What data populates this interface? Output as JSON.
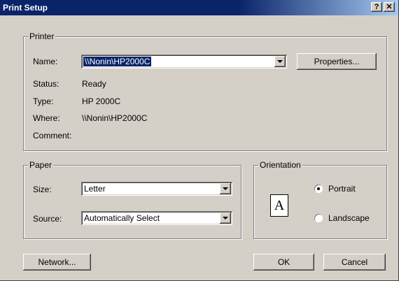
{
  "dialog": {
    "title": "Print Setup",
    "help_btn": "?",
    "close_btn": "✕"
  },
  "printer": {
    "group_label": "Printer",
    "name_label": "Name:",
    "name_value": "\\\\Nonin\\HP2000C",
    "properties_button": "Properties...",
    "status_label": "Status:",
    "status_value": "Ready",
    "type_label": "Type:",
    "type_value": "HP 2000C",
    "where_label": "Where:",
    "where_value": "\\\\Nonin\\HP2000C",
    "comment_label": "Comment:",
    "comment_value": ""
  },
  "paper": {
    "group_label": "Paper",
    "size_label": "Size:",
    "size_value": "Letter",
    "source_label": "Source:",
    "source_value": "Automatically Select"
  },
  "orientation": {
    "group_label": "Orientation",
    "icon_letter": "A",
    "portrait_label": "Portrait",
    "landscape_label": "Landscape",
    "selected": "Portrait"
  },
  "buttons": {
    "network": "Network...",
    "ok": "OK",
    "cancel": "Cancel"
  }
}
